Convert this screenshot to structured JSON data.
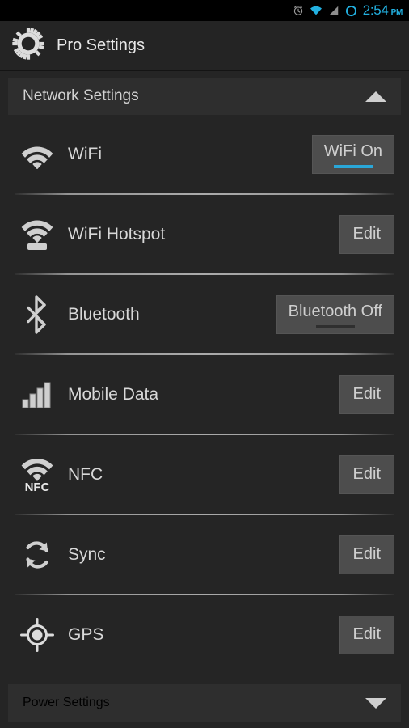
{
  "statusbar": {
    "icons": [
      "alarm-icon",
      "wifi-icon",
      "signal-icon",
      "circle-icon"
    ],
    "time": "2:54",
    "ampm": "PM",
    "accent_color": "#22b0e0"
  },
  "actionbar": {
    "icon": "gear-icon",
    "title": "Pro Settings"
  },
  "sections": {
    "network": {
      "label": "Network Settings",
      "expanded": true,
      "chevron": "chevron-up-icon"
    },
    "power": {
      "label": "Power Settings",
      "expanded": false,
      "chevron": "chevron-down-icon"
    }
  },
  "rows": [
    {
      "icon": "wifi-icon",
      "label": "WiFi",
      "action": "WiFi On",
      "type": "toggle",
      "state": "on"
    },
    {
      "icon": "wifi-hotspot-icon",
      "label": "WiFi Hotspot",
      "action": "Edit",
      "type": "edit",
      "state": ""
    },
    {
      "icon": "bluetooth-icon",
      "label": "Bluetooth",
      "action": "Bluetooth Off",
      "type": "toggle",
      "state": "off"
    },
    {
      "icon": "mobile-data-icon",
      "label": "Mobile Data",
      "action": "Edit",
      "type": "edit",
      "state": ""
    },
    {
      "icon": "nfc-icon",
      "label": "NFC",
      "action": "Edit",
      "type": "edit",
      "state": ""
    },
    {
      "icon": "sync-icon",
      "label": "Sync",
      "action": "Edit",
      "type": "edit",
      "state": ""
    },
    {
      "icon": "gps-icon",
      "label": "GPS",
      "action": "Edit",
      "type": "edit",
      "state": ""
    }
  ],
  "colors": {
    "accent": "#2aa7d8",
    "background": "#252525",
    "section_header": "#2e2e2e",
    "button": "#4d4d4d",
    "text": "#d8d8d8"
  }
}
